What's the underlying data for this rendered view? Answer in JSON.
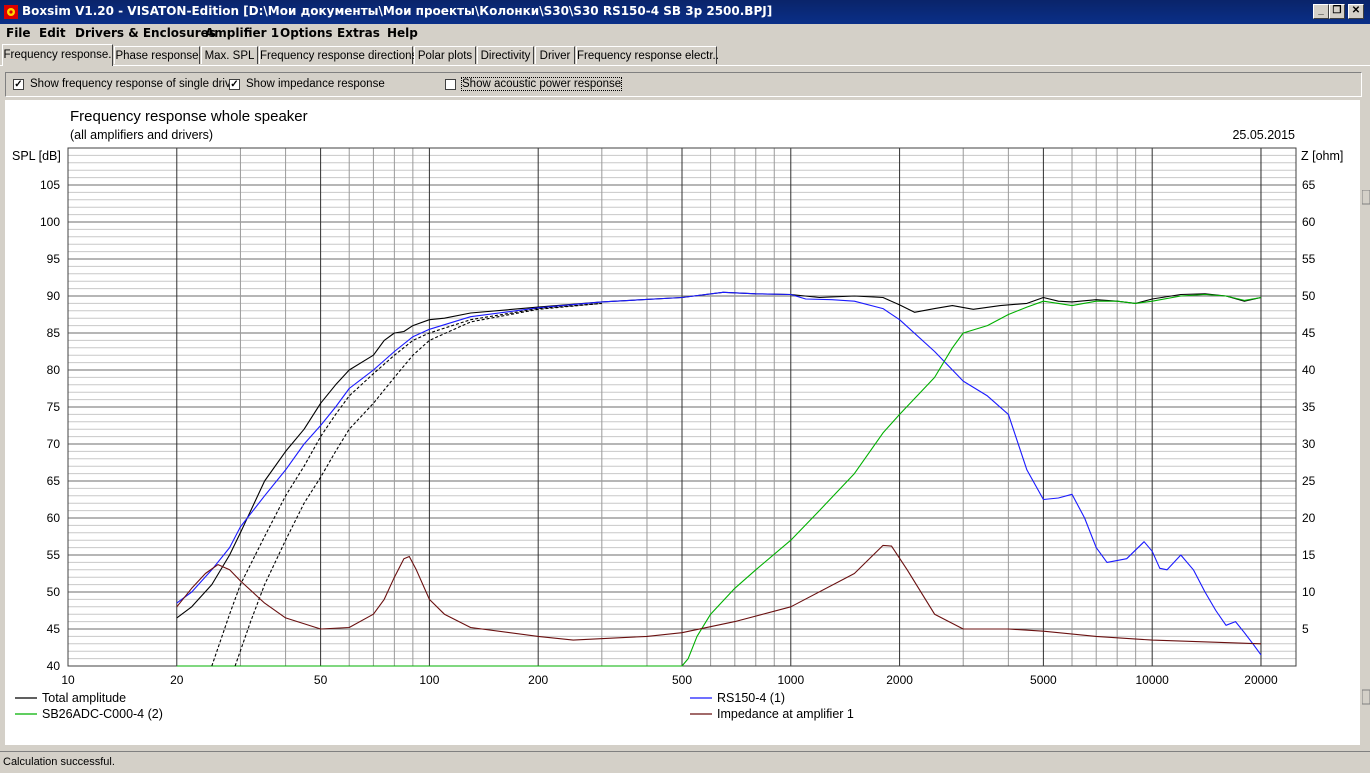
{
  "window": {
    "title": "Boxsim V1.20 - VISATON-Edition [D:\\Мои документы\\Мои проекты\\Колонки\\S30\\S30 RS150-4 SB 3p 2500.BPJ]"
  },
  "menu": [
    {
      "label": "File"
    },
    {
      "label": "Edit"
    },
    {
      "label": "Drivers & Enclosures"
    },
    {
      "label": "Amplifier 1"
    },
    {
      "label": "Options"
    },
    {
      "label": "Extras"
    },
    {
      "label": "Help"
    }
  ],
  "tabs": [
    {
      "label": "Frequency response.",
      "active": true
    },
    {
      "label": "Phase response"
    },
    {
      "label": "Max. SPL"
    },
    {
      "label": "Frequency response directions"
    },
    {
      "label": "Polar plots"
    },
    {
      "label": "Directivity"
    },
    {
      "label": "Driver"
    },
    {
      "label": "Frequency response electr.."
    }
  ],
  "options": {
    "single_drive": {
      "label": "Show frequency response of single drive",
      "checked": true
    },
    "impedance": {
      "label": "Show impedance response",
      "checked": true
    },
    "acoustic_power": {
      "label": "Show acoustic power response",
      "checked": false
    }
  },
  "status": {
    "text": "Calculation successful."
  },
  "chart_data": {
    "type": "line",
    "title": "Frequency response whole speaker",
    "subtitle": "(all amplifiers and drivers)",
    "date": "25.05.2015",
    "ylabel": "SPL [dB]",
    "y2label": "Z [ohm]",
    "xscale": "log",
    "xlim": [
      10,
      25000
    ],
    "ylim": [
      40,
      110
    ],
    "y2lim": [
      0,
      70
    ],
    "grid": true,
    "x_ticks": [
      10,
      20,
      50,
      100,
      200,
      500,
      1000,
      2000,
      5000,
      10000,
      20000
    ],
    "y_ticks": [
      40,
      45,
      50,
      55,
      60,
      65,
      70,
      75,
      80,
      85,
      90,
      95,
      100,
      105
    ],
    "y2_ticks": [
      5,
      10,
      15,
      20,
      25,
      30,
      35,
      40,
      45,
      50,
      55,
      60,
      65
    ],
    "series": [
      {
        "name": "Total amplitude",
        "color": "#000000",
        "axis": "left",
        "points": [
          [
            20,
            46.5
          ],
          [
            22,
            48
          ],
          [
            25,
            51
          ],
          [
            28,
            55
          ],
          [
            30,
            58
          ],
          [
            35,
            65
          ],
          [
            40,
            69
          ],
          [
            45,
            72
          ],
          [
            50,
            75.5
          ],
          [
            55,
            78
          ],
          [
            60,
            80
          ],
          [
            70,
            82
          ],
          [
            75,
            84
          ],
          [
            80,
            85
          ],
          [
            85,
            85.2
          ],
          [
            90,
            86
          ],
          [
            100,
            86.8
          ],
          [
            110,
            87
          ],
          [
            130,
            87.7
          ],
          [
            200,
            88.5
          ],
          [
            300,
            89.2
          ],
          [
            500,
            89.8
          ],
          [
            650,
            90.5
          ],
          [
            800,
            90.3
          ],
          [
            1000,
            90.2
          ],
          [
            1200,
            89.8
          ],
          [
            1500,
            90
          ],
          [
            1800,
            89.8
          ],
          [
            2000,
            88.8
          ],
          [
            2200,
            87.8
          ],
          [
            2500,
            88.3
          ],
          [
            2800,
            88.7
          ],
          [
            3200,
            88.2
          ],
          [
            3800,
            88.7
          ],
          [
            4500,
            89
          ],
          [
            5000,
            89.8
          ],
          [
            5500,
            89.3
          ],
          [
            6000,
            89.2
          ],
          [
            7000,
            89.5
          ],
          [
            8000,
            89.3
          ],
          [
            9000,
            89
          ],
          [
            10000,
            89.6
          ],
          [
            12000,
            90.2
          ],
          [
            14000,
            90.3
          ],
          [
            16000,
            90
          ],
          [
            18000,
            89.3
          ],
          [
            20000,
            89.8
          ]
        ]
      },
      {
        "name": "RS150-4 (1)",
        "color": "#1a1aff",
        "axis": "left",
        "points": [
          [
            20,
            48.5
          ],
          [
            22,
            50
          ],
          [
            25,
            53
          ],
          [
            28,
            56
          ],
          [
            30,
            58.8
          ],
          [
            35,
            63
          ],
          [
            40,
            66.5
          ],
          [
            45,
            70
          ],
          [
            50,
            72.5
          ],
          [
            55,
            75
          ],
          [
            60,
            77.5
          ],
          [
            70,
            80
          ],
          [
            80,
            82.5
          ],
          [
            90,
            84.5
          ],
          [
            100,
            85.5
          ],
          [
            130,
            87.2
          ],
          [
            200,
            88.4
          ],
          [
            300,
            89.2
          ],
          [
            500,
            89.8
          ],
          [
            650,
            90.5
          ],
          [
            800,
            90.3
          ],
          [
            1000,
            90.2
          ],
          [
            1100,
            89.6
          ],
          [
            1300,
            89.5
          ],
          [
            1500,
            89.3
          ],
          [
            1800,
            88.3
          ],
          [
            2000,
            86.8
          ],
          [
            2500,
            82.5
          ],
          [
            3000,
            78.5
          ],
          [
            3500,
            76.5
          ],
          [
            4000,
            74
          ],
          [
            4500,
            66.5
          ],
          [
            5000,
            62.5
          ],
          [
            5500,
            62.7
          ],
          [
            6000,
            63.2
          ],
          [
            6500,
            60
          ],
          [
            7000,
            56
          ],
          [
            7500,
            54
          ],
          [
            8500,
            54.5
          ],
          [
            9500,
            56.8
          ],
          [
            10000,
            55.5
          ],
          [
            10500,
            53.2
          ],
          [
            11000,
            53
          ],
          [
            12000,
            55
          ],
          [
            13000,
            53
          ],
          [
            14000,
            50
          ],
          [
            15000,
            47.5
          ],
          [
            16000,
            45.5
          ],
          [
            17000,
            46
          ],
          [
            18000,
            44.5
          ],
          [
            19000,
            43
          ],
          [
            20000,
            41.5
          ]
        ]
      },
      {
        "name": "SB26ADC-C000-4 (2)",
        "color": "#00b000",
        "axis": "left",
        "points": [
          [
            20,
            40
          ],
          [
            500,
            40
          ],
          [
            520,
            41
          ],
          [
            550,
            44
          ],
          [
            600,
            47
          ],
          [
            700,
            50.5
          ],
          [
            800,
            53
          ],
          [
            1000,
            57
          ],
          [
            1200,
            61
          ],
          [
            1500,
            66
          ],
          [
            1800,
            71.5
          ],
          [
            2000,
            74
          ],
          [
            2500,
            79
          ],
          [
            2800,
            83
          ],
          [
            3000,
            85
          ],
          [
            3500,
            86
          ],
          [
            4000,
            87.5
          ],
          [
            4500,
            88.5
          ],
          [
            5000,
            89.3
          ],
          [
            5500,
            89
          ],
          [
            6000,
            88.7
          ],
          [
            7000,
            89.3
          ],
          [
            8000,
            89.3
          ],
          [
            9000,
            89
          ],
          [
            10000,
            89.3
          ],
          [
            12000,
            90
          ],
          [
            14000,
            90.2
          ],
          [
            16000,
            90
          ],
          [
            18000,
            89.4
          ],
          [
            20000,
            89.8
          ]
        ]
      },
      {
        "name": "",
        "color": "#000000",
        "axis": "left",
        "dashed": true,
        "points": [
          [
            25,
            40
          ],
          [
            28,
            47
          ],
          [
            30,
            51
          ],
          [
            35,
            57.5
          ],
          [
            40,
            63
          ],
          [
            45,
            67
          ],
          [
            50,
            71
          ],
          [
            55,
            74
          ],
          [
            60,
            76.5
          ],
          [
            70,
            79.5
          ],
          [
            80,
            82
          ],
          [
            90,
            84
          ],
          [
            100,
            85
          ],
          [
            130,
            86.8
          ],
          [
            200,
            88.3
          ],
          [
            300,
            89
          ]
        ]
      },
      {
        "name": "",
        "color": "#000000",
        "axis": "left",
        "dashed": true,
        "points": [
          [
            29,
            40
          ],
          [
            32,
            46
          ],
          [
            35,
            51
          ],
          [
            40,
            57
          ],
          [
            45,
            62
          ],
          [
            50,
            65.5
          ],
          [
            55,
            69
          ],
          [
            60,
            72
          ],
          [
            70,
            75.5
          ],
          [
            80,
            79
          ],
          [
            90,
            82
          ],
          [
            100,
            84
          ],
          [
            130,
            86.5
          ],
          [
            200,
            88.2
          ],
          [
            300,
            89
          ]
        ]
      },
      {
        "name": "Impedance at amplifier 1",
        "color": "#6a1010",
        "axis": "right",
        "points": [
          [
            20,
            8
          ],
          [
            22,
            10.5
          ],
          [
            24,
            12.5
          ],
          [
            26,
            13.7
          ],
          [
            28,
            13
          ],
          [
            30,
            11.5
          ],
          [
            35,
            8.5
          ],
          [
            40,
            6.5
          ],
          [
            50,
            5
          ],
          [
            60,
            5.2
          ],
          [
            70,
            7
          ],
          [
            75,
            9
          ],
          [
            80,
            12
          ],
          [
            85,
            14.5
          ],
          [
            88,
            14.8
          ],
          [
            92,
            13
          ],
          [
            100,
            9
          ],
          [
            110,
            7
          ],
          [
            130,
            5.2
          ],
          [
            200,
            4
          ],
          [
            250,
            3.5
          ],
          [
            400,
            4
          ],
          [
            500,
            4.5
          ],
          [
            700,
            6
          ],
          [
            1000,
            8
          ],
          [
            1500,
            12.5
          ],
          [
            1800,
            16.3
          ],
          [
            1900,
            16.2
          ],
          [
            2100,
            13
          ],
          [
            2500,
            7
          ],
          [
            3000,
            5
          ],
          [
            4000,
            5
          ],
          [
            5000,
            4.7
          ],
          [
            7000,
            4
          ],
          [
            10000,
            3.5
          ],
          [
            20000,
            3
          ]
        ]
      }
    ]
  }
}
